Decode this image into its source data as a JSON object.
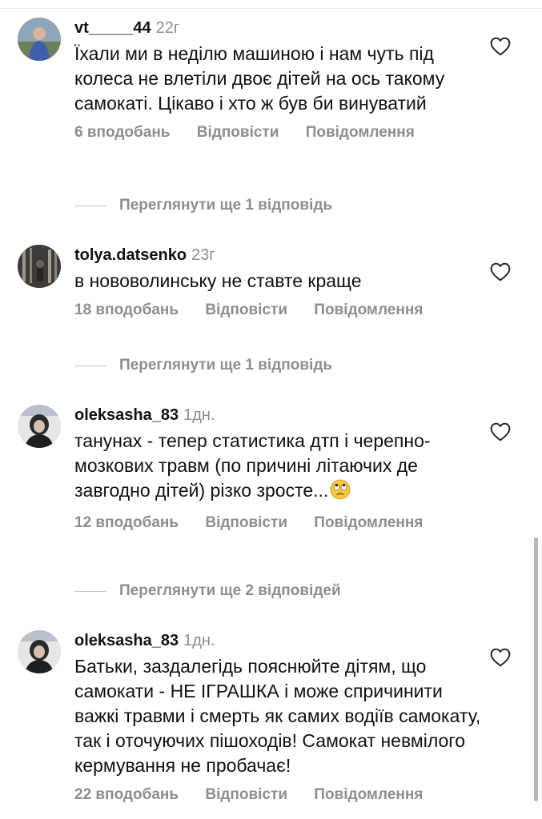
{
  "comments": [
    {
      "username": "vt_____44",
      "time": "22г",
      "text": "Їхали ми в неділю машиною і нам чуть під колеса не влетіли двоє дітей на ось такому самокаті. Цікаво і хто ж був би винуватий",
      "likes": "6 вподобань",
      "reply": "Відповісти",
      "report": "Повідомлення",
      "more_replies": "Переглянути ще 1 відповідь"
    },
    {
      "username": "tolya.datsenko",
      "time": "23г",
      "text": "в нововолинську не ставте краще",
      "likes": "18 вподобань",
      "reply": "Відповісти",
      "report": "Повідомлення",
      "more_replies": "Переглянути ще 1 відповідь"
    },
    {
      "username": "oleksasha_83",
      "time": "1дн.",
      "text": "танунах - тепер статистика дтп і черепно-мозкових травм (по причині літаючих де завгодно дітей) різко зросте...",
      "likes": "12 вподобань",
      "reply": "Відповісти",
      "report": "Повідомлення",
      "more_replies": "Переглянути ще 2 відповідей"
    },
    {
      "username": "oleksasha_83",
      "time": "1дн.",
      "text": "Батьки, заздалегідь пояснюйте дітям, що самокати - НЕ ІГРАШКА і може спричинити важкі травми і смерть як самих водіїв самокату, так і оточуючих пішоходів! Самокат невмілого кермування не пробачає!",
      "likes": "22 вподобань",
      "reply": "Відповісти",
      "report": "Повідомлення"
    }
  ],
  "icons": {
    "like": "heart-outline-icon",
    "emoji": "face-with-rolling-eyes-emoji"
  },
  "colors": {
    "secondary_text": "#8e8e8e",
    "primary_text": "#111111"
  }
}
